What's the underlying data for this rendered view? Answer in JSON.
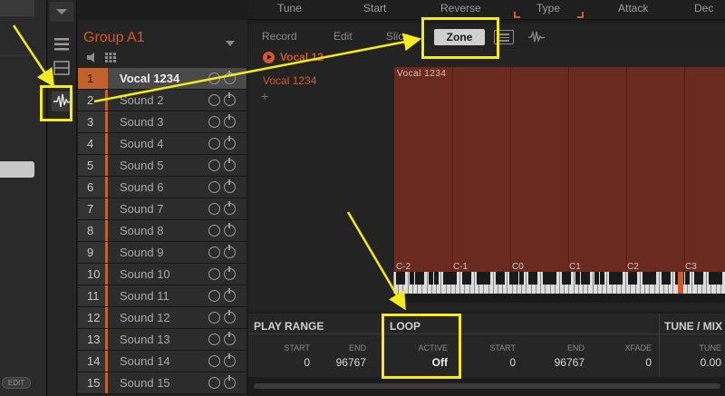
{
  "group": {
    "title": "Group A1"
  },
  "sounds": [
    {
      "num": "1",
      "name": "Vocal 1234",
      "selected": true
    },
    {
      "num": "2",
      "name": "Sound 2"
    },
    {
      "num": "3",
      "name": "Sound 3"
    },
    {
      "num": "4",
      "name": "Sound 4"
    },
    {
      "num": "5",
      "name": "Sound 5"
    },
    {
      "num": "6",
      "name": "Sound 6"
    },
    {
      "num": "7",
      "name": "Sound 7"
    },
    {
      "num": "8",
      "name": "Sound 8"
    },
    {
      "num": "9",
      "name": "Sound 9"
    },
    {
      "num": "10",
      "name": "Sound 10"
    },
    {
      "num": "11",
      "name": "Sound 11"
    },
    {
      "num": "12",
      "name": "Sound 12"
    },
    {
      "num": "13",
      "name": "Sound 13"
    },
    {
      "num": "14",
      "name": "Sound 14"
    },
    {
      "num": "15",
      "name": "Sound 15"
    }
  ],
  "left_strip": {
    "edit_label": "EDIT"
  },
  "param_header": {
    "tune": "Tune",
    "start": "Start",
    "reverse": "Reverse",
    "type": "Type",
    "attack": "Attack",
    "decay": "Dec"
  },
  "tabs": {
    "record": "Record",
    "edit": "Edit",
    "slice": "Slice",
    "zone": "Zone"
  },
  "sample_panel": {
    "header": "Vocal 12",
    "item": "Vocal 1234",
    "add": "+"
  },
  "zone_map": {
    "sample_name": "Vocal 1234",
    "notes": [
      "C-2",
      "C-1",
      "C0",
      "C1",
      "C2",
      "C3"
    ]
  },
  "bottom": {
    "play_range": {
      "title": "PLAY RANGE",
      "start_label": "START",
      "start_value": "0",
      "end_label": "END",
      "end_value": "96767"
    },
    "loop": {
      "title": "LOOP",
      "active_label": "ACTIVE",
      "active_value": "Off",
      "start_label": "START",
      "start_value": "0",
      "end_label": "END",
      "end_value": "96767",
      "xfade_label": "XFADE",
      "xfade_value": "0"
    },
    "tune_mix": {
      "title": "TUNE / MIX",
      "tune_label": "TUNE",
      "tune_value": "0.00"
    }
  },
  "colors": {
    "accent": "#d35a26",
    "zone_fill": "#6a2a1e",
    "highlight": "#f5ea1c"
  }
}
